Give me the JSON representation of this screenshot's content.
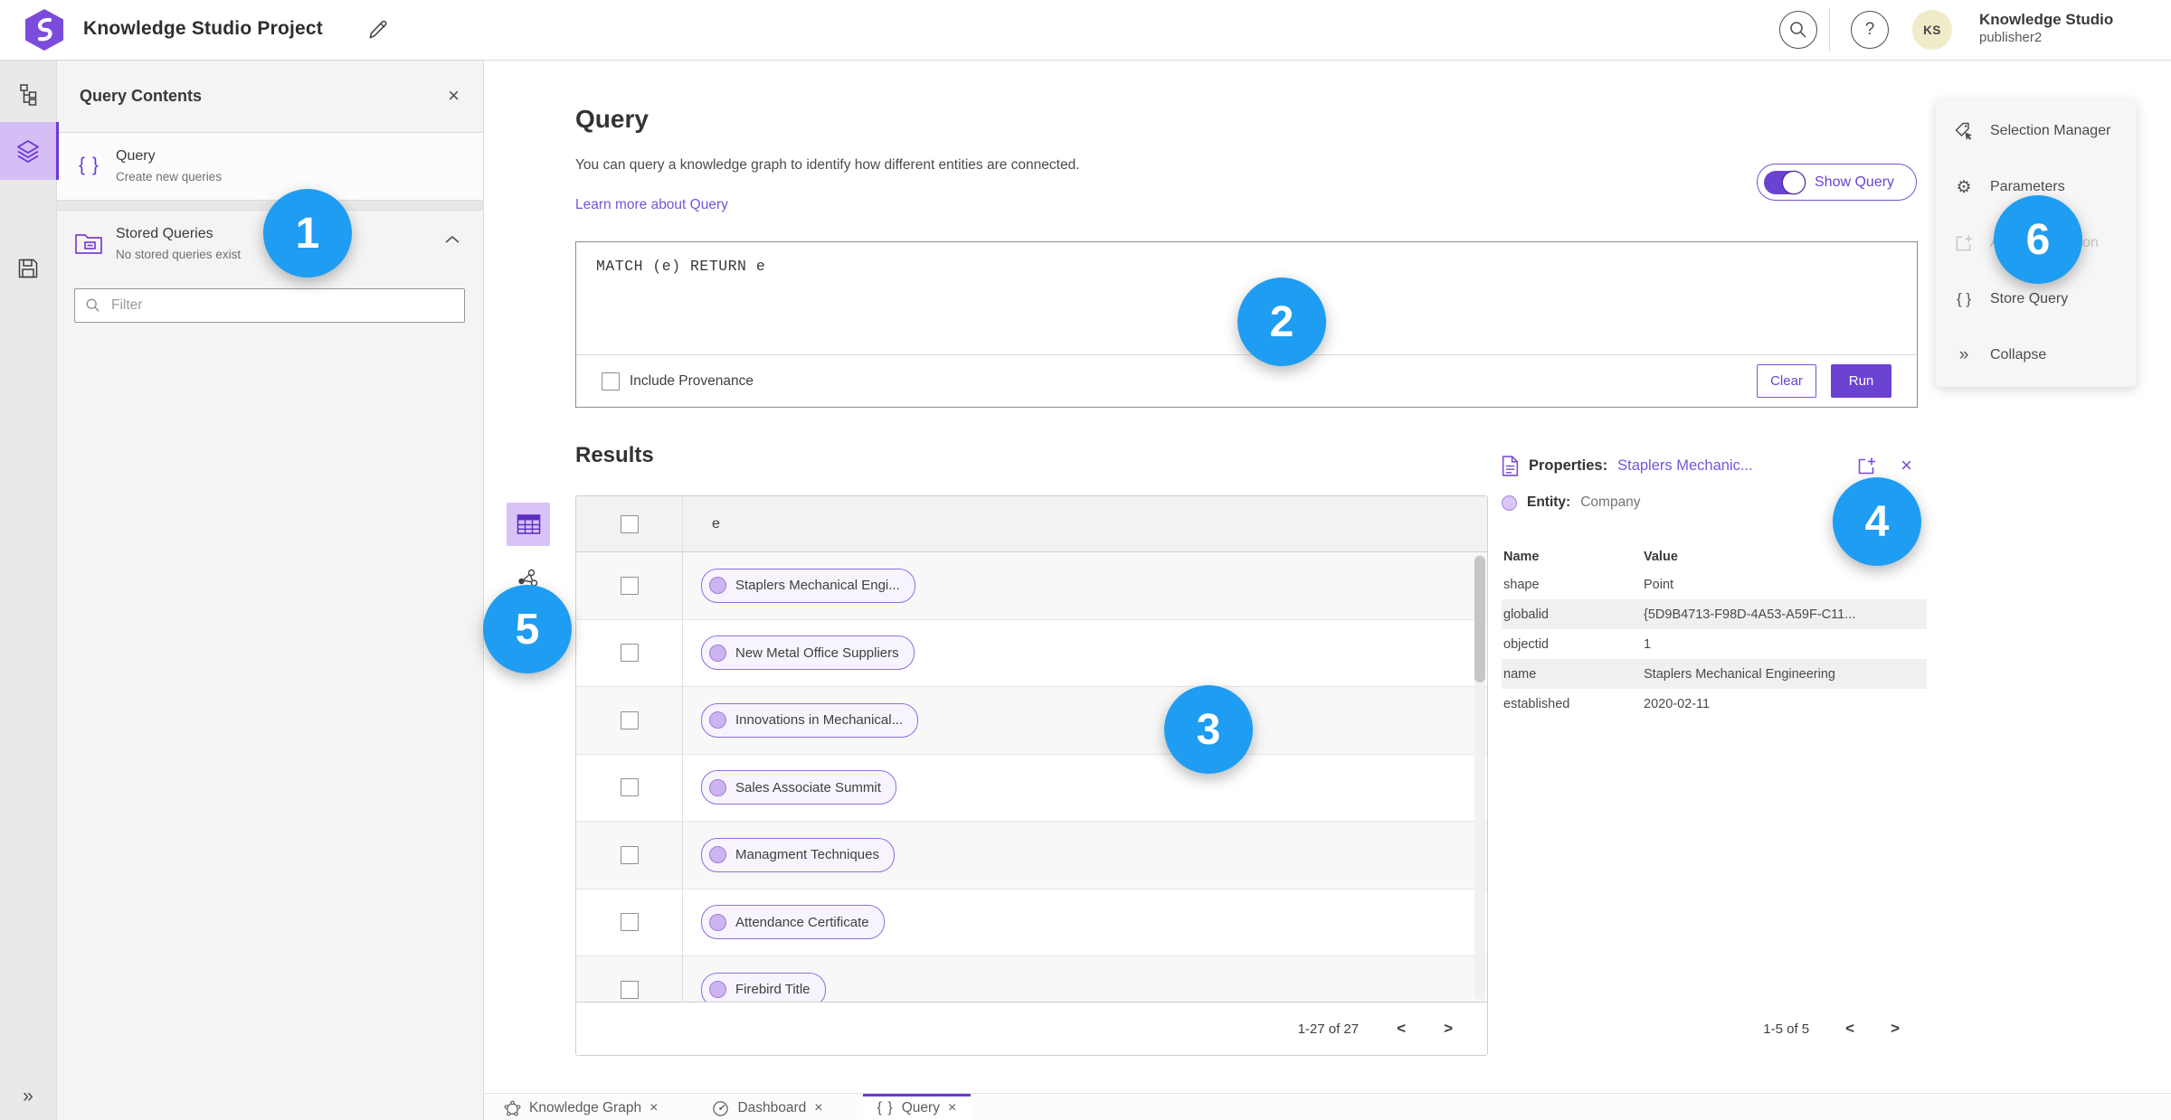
{
  "app": {
    "title": "Knowledge Studio Project",
    "user_name": "Knowledge Studio",
    "user_role": "publisher2",
    "avatar_initials": "KS"
  },
  "glyphs": {
    "braces": "{ }",
    "collapse": "»",
    "gear": "⚙",
    "close": "×",
    "help": "?",
    "prev": "<",
    "next": ">"
  },
  "left_panel": {
    "title": "Query Contents",
    "query_item": {
      "label": "Query",
      "sublabel": "Create new queries"
    },
    "stored_item": {
      "label": "Stored Queries",
      "sublabel": "No stored queries exist"
    },
    "filter_placeholder": "Filter"
  },
  "query_section": {
    "heading": "Query",
    "description": "You can query a knowledge graph to identify how different entities are connected.",
    "learn_more": "Learn more about Query",
    "show_query_label": "Show Query",
    "query_text": "MATCH (e) RETURN e",
    "include_provenance_label": "Include Provenance",
    "clear_label": "Clear",
    "run_label": "Run"
  },
  "results": {
    "heading": "Results",
    "column_header": "e",
    "rows": [
      "Staplers Mechanical Engi...",
      "New Metal Office Suppliers",
      "Innovations in Mechanical...",
      "Sales Associate Summit",
      "Managment Techniques",
      "Attendance Certificate",
      "Firebird Title"
    ],
    "pagination": "1-27 of 27"
  },
  "properties_panel": {
    "title_label": "Properties:",
    "title_link": "Staplers Mechanic...",
    "entity_label": "Entity:",
    "entity_value": "Company",
    "col_name": "Name",
    "col_value": "Value",
    "rows": [
      {
        "name": "shape",
        "value": "Point"
      },
      {
        "name": "globalid",
        "value": "{5D9B4713-F98D-4A53-A59F-C11..."
      },
      {
        "name": "objectid",
        "value": "1"
      },
      {
        "name": "name",
        "value": "Staplers Mechanical Engineering"
      },
      {
        "name": "established",
        "value": "2020-02-11"
      }
    ],
    "pagination": "1-5 of 5"
  },
  "right_menu": {
    "items": [
      {
        "label": "Selection Manager",
        "disabled": false
      },
      {
        "label": "Parameters",
        "disabled": false
      },
      {
        "label": "Add To Selection",
        "disabled": true
      },
      {
        "label": "Store Query",
        "disabled": false
      },
      {
        "label": "Collapse",
        "disabled": false
      }
    ]
  },
  "tabs": [
    {
      "label": "Knowledge Graph",
      "active": false
    },
    {
      "label": "Dashboard",
      "active": false
    },
    {
      "label": "Query",
      "active": true
    }
  ],
  "badges": [
    "1",
    "2",
    "3",
    "4",
    "5",
    "6"
  ],
  "colors": {
    "accent_purple": "#6a43d3",
    "accent_purple_light": "#d5bef5",
    "badge_blue": "#1e9df2",
    "link_purple": "#7456d8",
    "pill_fill": "#f7f4fd",
    "pill_border": "#8f6ee0"
  }
}
